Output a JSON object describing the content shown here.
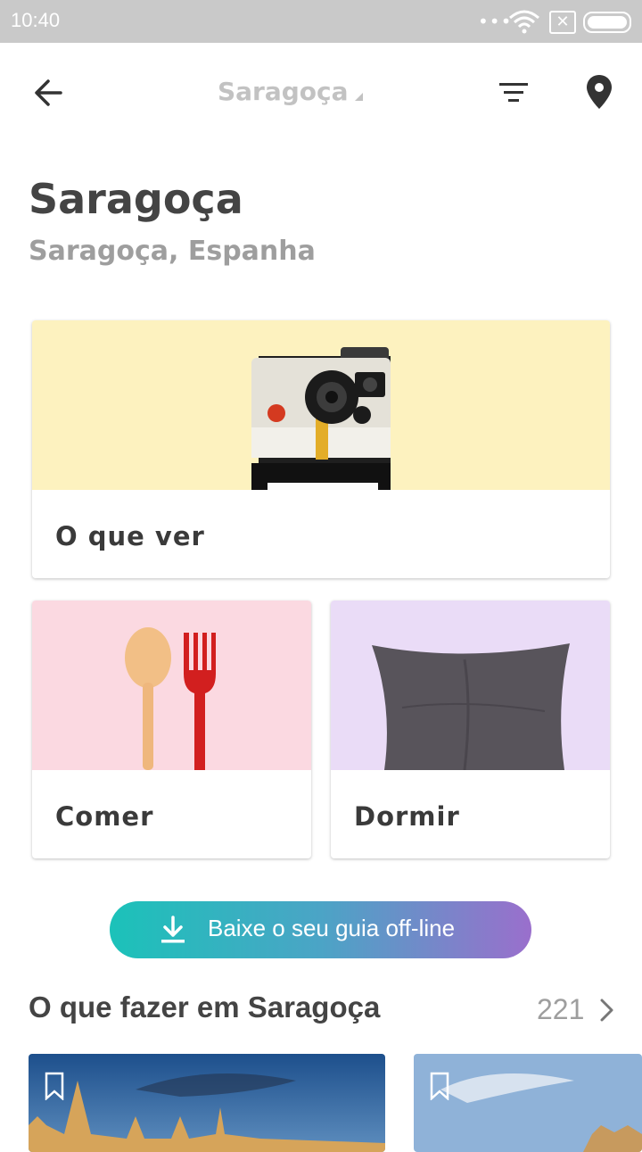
{
  "status_bar": {
    "time": "10:40",
    "dots": "•••",
    "x_label": "✕"
  },
  "app_bar": {
    "title": "Saragoça"
  },
  "header": {
    "title": "Saragoça",
    "subtitle": "Saragoça, Espanha"
  },
  "categories": [
    {
      "label": "O que ver",
      "bg_color": "#fdf2bf"
    },
    {
      "label": "Comer",
      "bg_color": "#fbd9e1"
    },
    {
      "label": "Dormir",
      "bg_color": "#eadcf7"
    }
  ],
  "download_button": {
    "label": "Baixe o seu guia off-line"
  },
  "section": {
    "title": "O que fazer em Saragoça",
    "count": "221"
  },
  "colors": {
    "accent_start": "#1bc2b9",
    "accent_end": "#9a6fcc",
    "text_dark": "#444444",
    "text_muted": "#9e9e9e"
  },
  "icons": [
    "back-arrow-icon",
    "filter-icon",
    "map-pin-icon",
    "download-icon",
    "chevron-right-icon",
    "bookmark-icon"
  ]
}
